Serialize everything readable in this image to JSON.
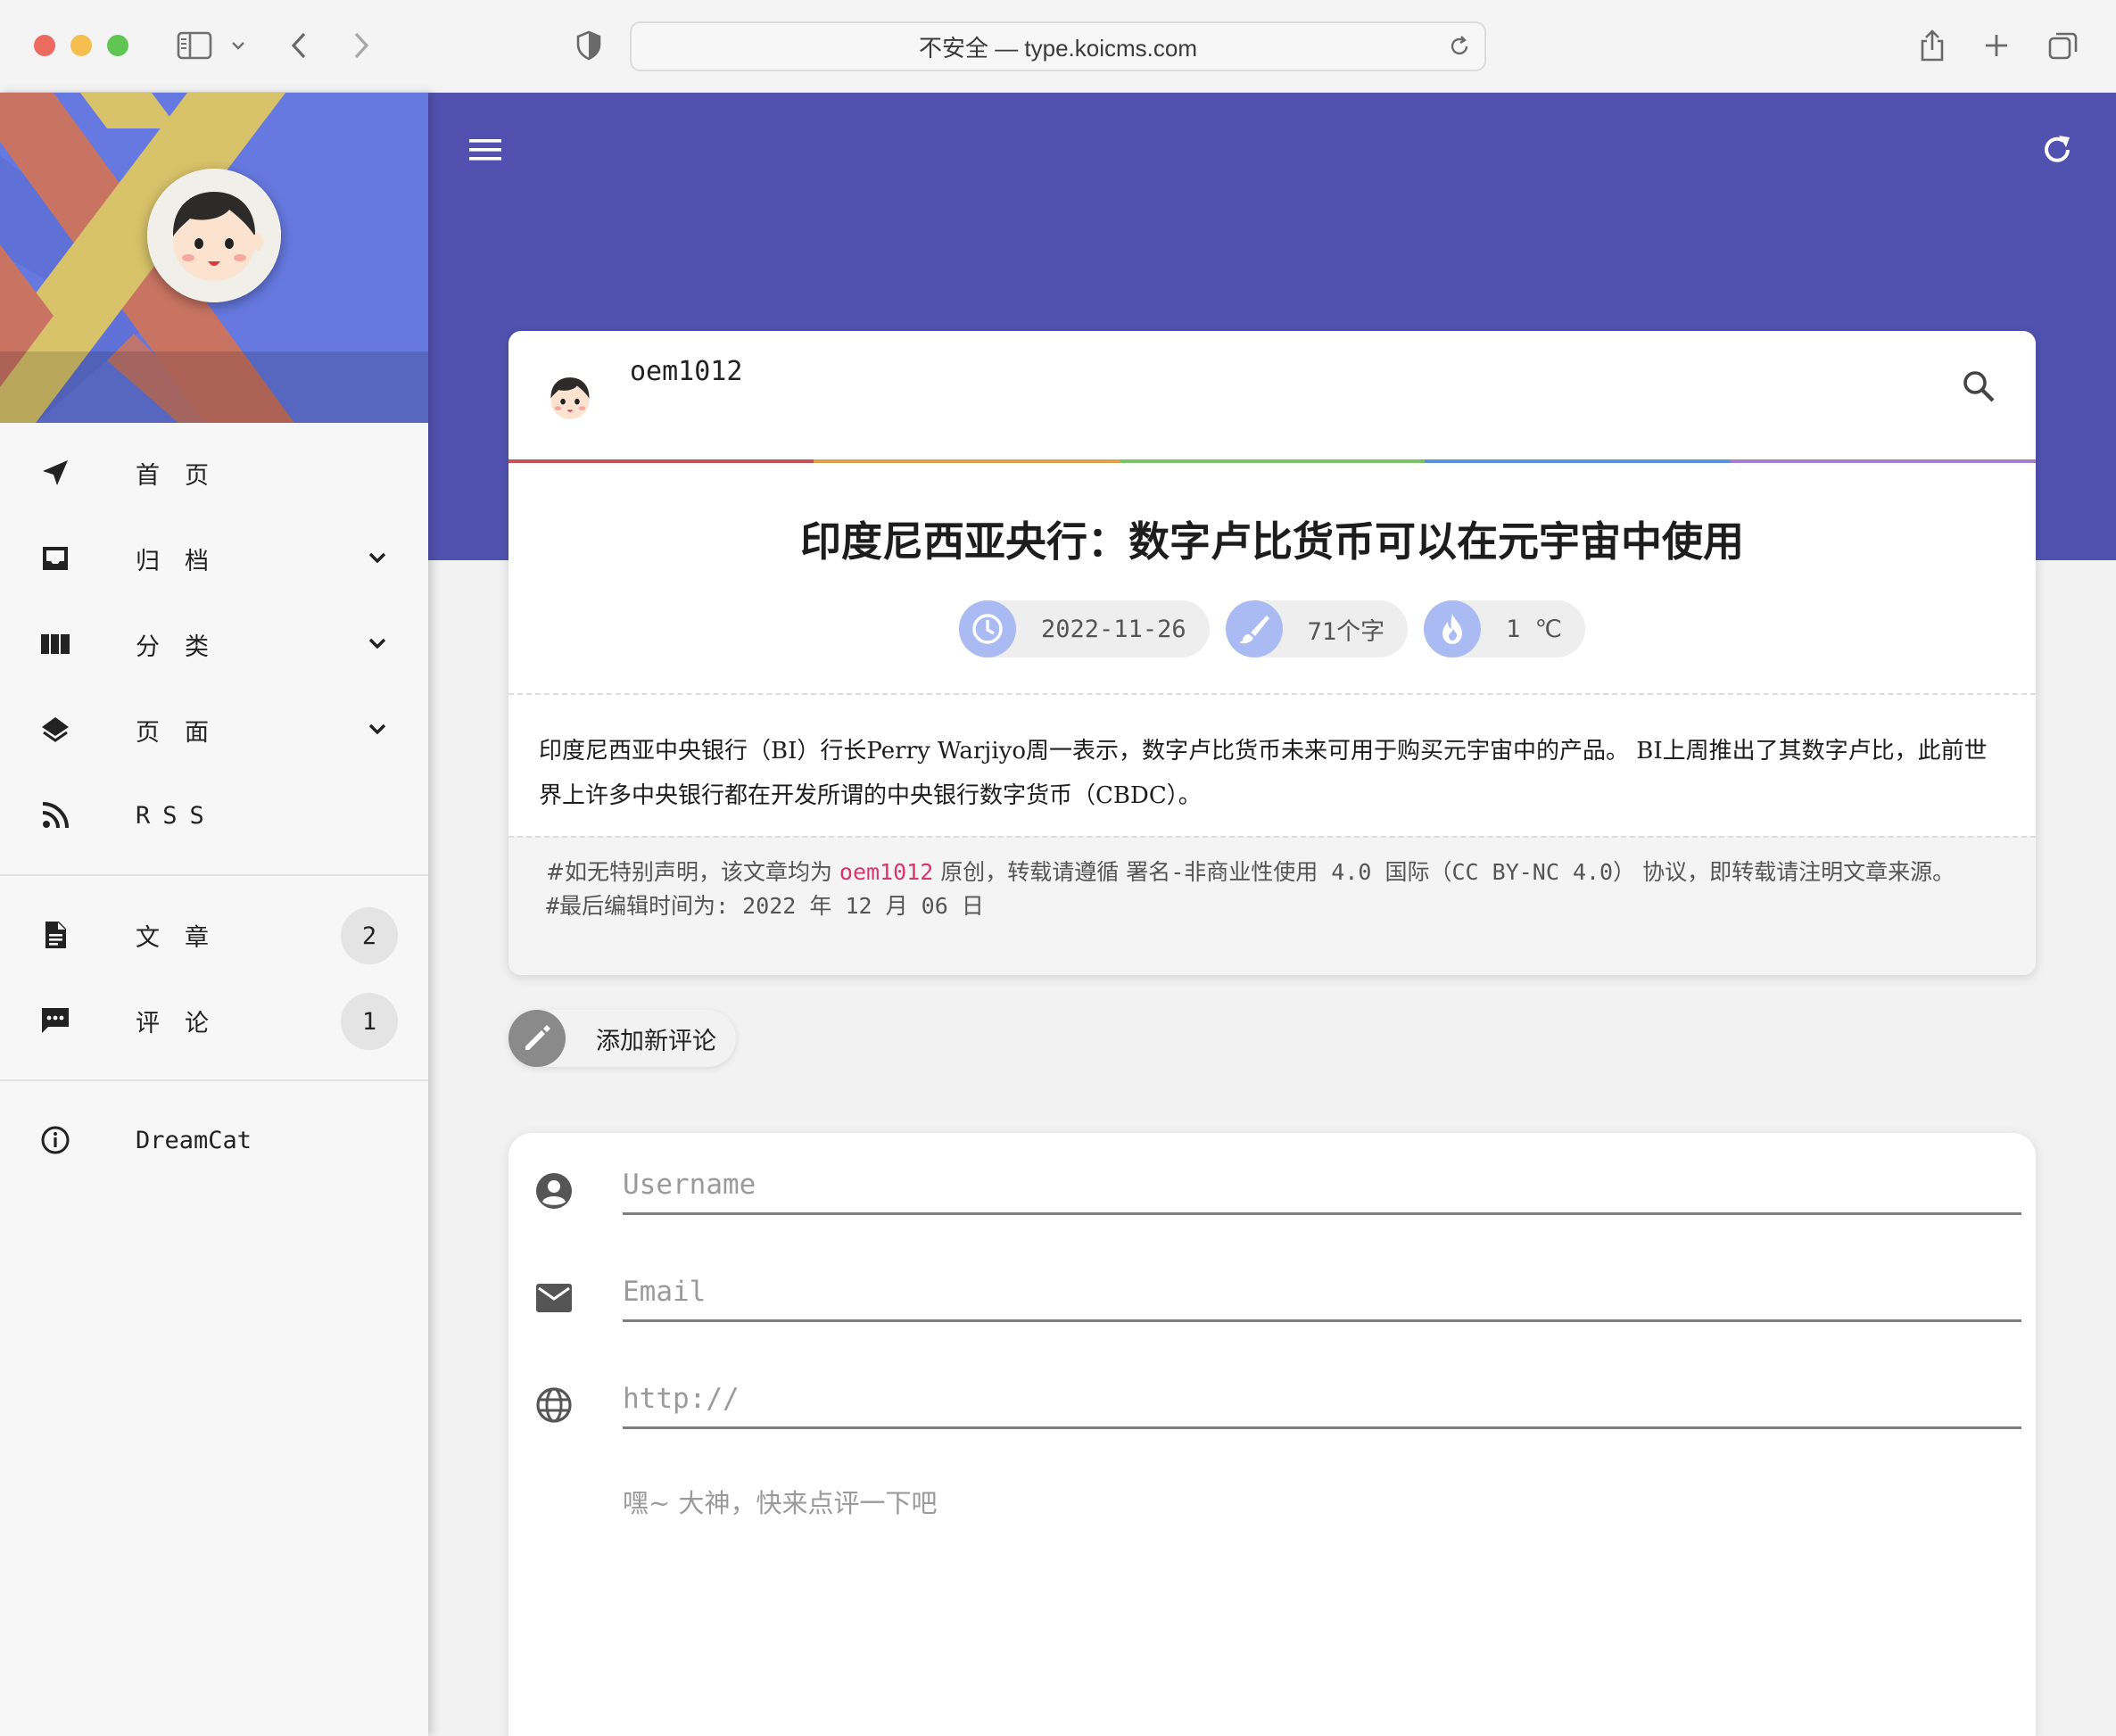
{
  "browser": {
    "url_text": "不安全 — type.koicms.com"
  },
  "sidebar": {
    "nav": [
      {
        "label": "首页",
        "icon": "send-icon",
        "expandable": false
      },
      {
        "label": "归档",
        "icon": "archive-icon",
        "expandable": true
      },
      {
        "label": "分类",
        "icon": "columns-icon",
        "expandable": true
      },
      {
        "label": "页面",
        "icon": "layers-icon",
        "expandable": true
      },
      {
        "label": "RSS",
        "icon": "rss-icon",
        "expandable": false
      }
    ],
    "stats": [
      {
        "label": "文章",
        "icon": "article-icon",
        "count": "2"
      },
      {
        "label": "评论",
        "icon": "comment-icon",
        "count": "1"
      }
    ],
    "about": {
      "label": "DreamCat",
      "icon": "info-icon"
    }
  },
  "post": {
    "author": "oem1012",
    "title": "印度尼西亚央行：数字卢比货币可以在元宇宙中使用",
    "meta": {
      "date": "2022-11-26",
      "words": "71个字",
      "heat": "1 ℃"
    },
    "body": "印度尼西亚中央银行（BI）行长Perry Warjiyo周一表示，数字卢比货币未来可用于购买元宇宙中的产品。 BI上周推出了其数字卢比，此前世界上许多中央银行都在开发所谓的中央银行数字货币（CBDC）。",
    "copyright": {
      "prefix": "#如无特别声明，该文章均为",
      "author": "oem1012",
      "middle": "原创，转载请遵循",
      "license": "署名-非商业性使用 4.0 国际（CC BY-NC 4.0）",
      "suffix": "协议，即转载请注明文章来源。",
      "edited": "#最后编辑时间为: 2022 年 12 月 06 日"
    }
  },
  "comment": {
    "add_label": "添加新评论",
    "username_placeholder": "Username",
    "email_placeholder": "Email",
    "url_placeholder": "http://",
    "content_placeholder": "嘿~ 大神，快来点评一下吧"
  },
  "colors": {
    "appbar": "#5152b0",
    "banner": "#6679e0",
    "accent_chip": "#a9bbf2",
    "highlight": "#d6366a",
    "rainbow": [
      "#c9515e",
      "#e0a048",
      "#7cc06a",
      "#5b8fe0",
      "#a47dcc"
    ]
  }
}
